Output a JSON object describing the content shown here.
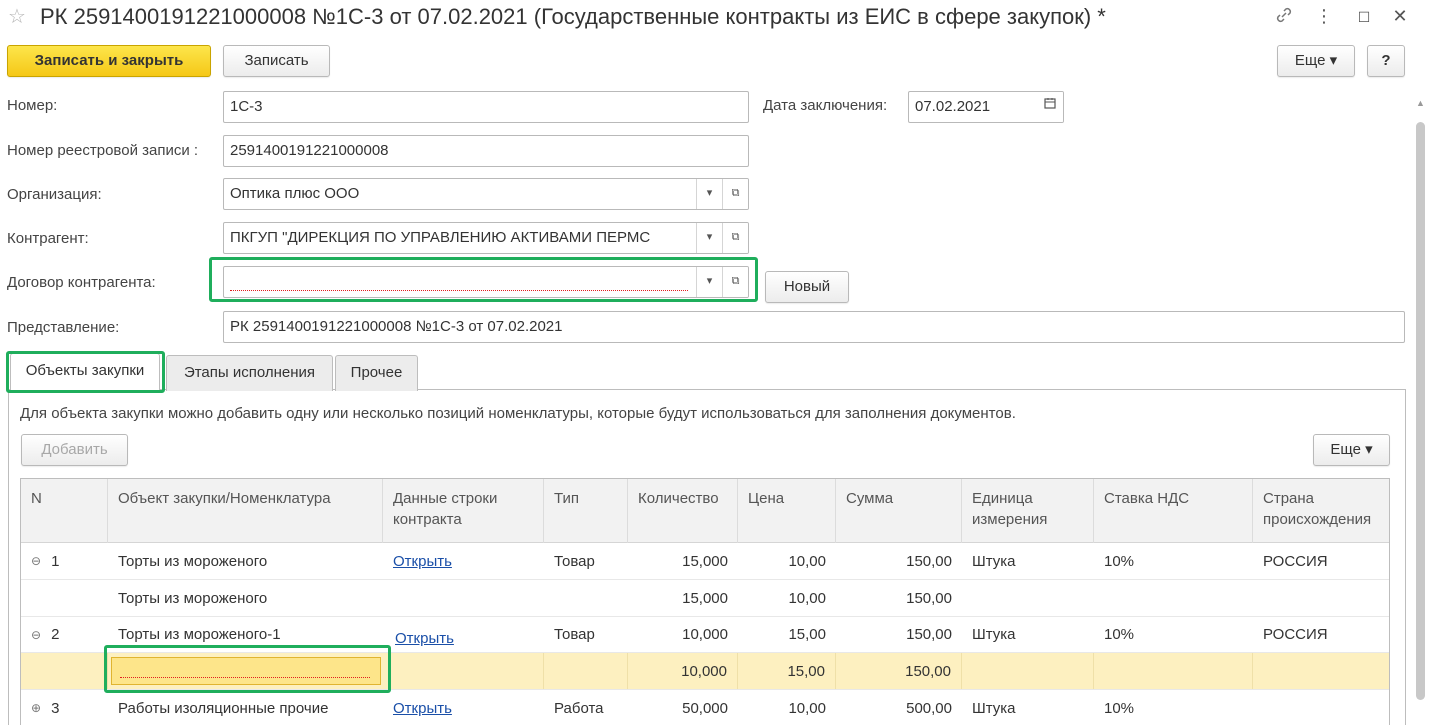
{
  "window": {
    "title": "РК 2591400191221000008 №1С-3 от 07.02.2021 (Государственные контракты из ЕИС в сфере закупок) *",
    "star_icon": "star-icon",
    "link_icon": "link-icon",
    "more_icon": "more-vert-icon",
    "maximize_icon": "maximize-icon",
    "close_icon": "close-icon"
  },
  "toolbar": {
    "save_close": "Записать и закрыть",
    "save": "Записать",
    "more": "Еще ▾",
    "help": "?"
  },
  "form": {
    "number_label": "Номер:",
    "number_value": "1С-3",
    "date_label": "Дата заключения:",
    "date_value": "07.02.2021",
    "registry_label": "Номер реестровой записи :",
    "registry_value": "2591400191221000008",
    "org_label": "Организация:",
    "org_value": "Оптика плюс ООО",
    "contractor_label": "Контрагент:",
    "contractor_value": "ПКГУП \"ДИРЕКЦИЯ ПО УПРАВЛЕНИЮ АКТИВАМИ ПЕРМС",
    "contract_label": "Договор контрагента:",
    "contract_value": "",
    "new_button": "Новый",
    "representation_label": "Представление:",
    "representation_value": "РК 2591400191221000008 №1С-3 от 07.02.2021"
  },
  "tabs": [
    {
      "label": "Объекты закупки",
      "active": true
    },
    {
      "label": "Этапы исполнения",
      "active": false
    },
    {
      "label": "Прочее",
      "active": false
    }
  ],
  "panel": {
    "info": "Для объекта закупки можно добавить одну или несколько позиций номенклатуры, которые будут использоваться для заполнения документов.",
    "add_button": "Добавить",
    "more_button": "Еще ▾"
  },
  "table": {
    "headers": {
      "n": "N",
      "object": "Объект закупки/Номенклатура",
      "contract_data_1": "Данные строки",
      "contract_data_2": "контракта",
      "type": "Тип",
      "qty": "Количество",
      "price": "Цена",
      "sum": "Сумма",
      "unit_1": "Единица",
      "unit_2": "измерения",
      "vat": "Ставка НДС",
      "country_1": "Страна",
      "country_2": "происхождения"
    },
    "rows": [
      {
        "tree": "⊖",
        "n": "1",
        "object": "Торты из мороженого",
        "link": "Открыть",
        "type": "Товар",
        "qty": "15,000",
        "price": "10,00",
        "sum": "150,00",
        "unit": "Штука",
        "vat": "10%",
        "country": "РОССИЯ"
      },
      {
        "tree": "",
        "n": "",
        "object": "Торты из мороженого",
        "link": "",
        "type": "",
        "qty": "15,000",
        "price": "10,00",
        "sum": "150,00",
        "unit": "",
        "vat": "",
        "country": ""
      },
      {
        "tree": "⊖",
        "n": "2",
        "object": "Торты из мороженого-1",
        "link": "Открыть",
        "type": "Товар",
        "qty": "10,000",
        "price": "15,00",
        "sum": "150,00",
        "unit": "Штука",
        "vat": "10%",
        "country": "РОССИЯ"
      },
      {
        "tree": "",
        "n": "",
        "object": "",
        "link": "",
        "type": "",
        "qty": "10,000",
        "price": "15,00",
        "sum": "150,00",
        "unit": "",
        "vat": "",
        "country": ""
      },
      {
        "tree": "⊕",
        "n": "3",
        "object": "Работы изоляционные прочие",
        "link": "Открыть",
        "type": "Работа",
        "qty": "50,000",
        "price": "10,00",
        "sum": "500,00",
        "unit": "Штука",
        "vat": "10%",
        "country": ""
      }
    ]
  },
  "colors": {
    "primary_button": "#f5c817",
    "highlight_border": "#1fae5c",
    "selected_row": "#fdf0c0",
    "link": "#1a4fa8",
    "error_underline": "#e02020"
  }
}
